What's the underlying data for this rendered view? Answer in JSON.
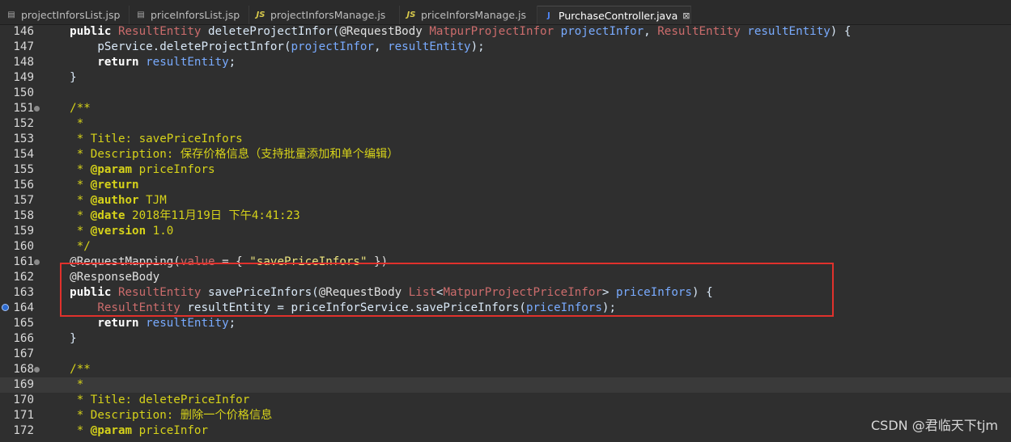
{
  "tabs": [
    {
      "label": "projectInforsList.jsp",
      "icon": "file-icon"
    },
    {
      "label": "priceInforsList.jsp",
      "icon": "file-icon"
    },
    {
      "label": "projectInforsManage.js",
      "icon": "js-file-icon"
    },
    {
      "label": "priceInforsManage.js",
      "icon": "js-file-icon"
    },
    {
      "label": "PurchaseController.java",
      "icon": "java-file-icon",
      "active": true,
      "close": "⊠"
    }
  ],
  "colors": {
    "keyword": "#cc7832",
    "keyword_bright": "#ffffff",
    "type": "#cc6c6c",
    "param": "#79abff",
    "comment": "#d6d21a",
    "annotation": "#e0e0e0",
    "string": "#ece47e",
    "default": "#d9e8f7",
    "highlight_box": "#e0312c"
  },
  "lines": [
    {
      "n": "146",
      "segs": [
        [
          "    ",
          "d"
        ],
        [
          "public",
          "kw"
        ],
        [
          " ",
          "d"
        ],
        [
          "ResultEntity",
          "t"
        ],
        [
          " deleteProjectInfor(",
          "d"
        ],
        [
          "@RequestBody",
          "a"
        ],
        [
          " ",
          "d"
        ],
        [
          "MatpurProjectInfor",
          "t"
        ],
        [
          " ",
          "d"
        ],
        [
          "projectInfor",
          "p"
        ],
        [
          ", ",
          "d"
        ],
        [
          "ResultEntity",
          "t"
        ],
        [
          " ",
          "d"
        ],
        [
          "resultEntity",
          "p"
        ],
        [
          ") {",
          "d"
        ]
      ]
    },
    {
      "n": "147",
      "segs": [
        [
          "        pService.deleteProjectInfor(",
          "d"
        ],
        [
          "projectInfor",
          "p"
        ],
        [
          ", ",
          "d"
        ],
        [
          "resultEntity",
          "p"
        ],
        [
          ");",
          "d"
        ]
      ]
    },
    {
      "n": "148",
      "segs": [
        [
          "        ",
          "d"
        ],
        [
          "return",
          "kw"
        ],
        [
          " ",
          "d"
        ],
        [
          "resultEntity",
          "p"
        ],
        [
          ";",
          "d"
        ]
      ]
    },
    {
      "n": "149",
      "segs": [
        [
          "    }",
          "d"
        ]
      ]
    },
    {
      "n": "150",
      "segs": []
    },
    {
      "n": "151",
      "fold": true,
      "segs": [
        [
          "    /**",
          "c"
        ]
      ]
    },
    {
      "n": "152",
      "segs": [
        [
          "     *",
          "c"
        ]
      ]
    },
    {
      "n": "153",
      "segs": [
        [
          "     * Title: savePriceInfors",
          "c"
        ]
      ]
    },
    {
      "n": "154",
      "segs": [
        [
          "     * Description: 保存价格信息（支持批量添加和单个编辑）",
          "c"
        ]
      ]
    },
    {
      "n": "155",
      "segs": [
        [
          "     * ",
          "c"
        ],
        [
          "@param",
          "cb"
        ],
        [
          " priceInfors",
          "c"
        ]
      ]
    },
    {
      "n": "156",
      "segs": [
        [
          "     * ",
          "c"
        ],
        [
          "@return",
          "cb"
        ]
      ]
    },
    {
      "n": "157",
      "segs": [
        [
          "     * ",
          "c"
        ],
        [
          "@author",
          "cb"
        ],
        [
          " TJM",
          "c"
        ]
      ]
    },
    {
      "n": "158",
      "segs": [
        [
          "     * ",
          "c"
        ],
        [
          "@date",
          "cb"
        ],
        [
          " 2018年11月19日 下午4:41:23",
          "c"
        ]
      ]
    },
    {
      "n": "159",
      "segs": [
        [
          "     * ",
          "c"
        ],
        [
          "@version",
          "cb"
        ],
        [
          " 1.0",
          "c"
        ]
      ]
    },
    {
      "n": "160",
      "segs": [
        [
          "     */",
          "c"
        ]
      ]
    },
    {
      "n": "161",
      "fold": true,
      "segs": [
        [
          "    @RequestMapping(",
          "a"
        ],
        [
          "value",
          "t"
        ],
        [
          " = { ",
          "a"
        ],
        [
          "\"savePriceInfors\"",
          "s"
        ],
        [
          " })",
          "a"
        ]
      ]
    },
    {
      "n": "162",
      "segs": [
        [
          "    @ResponseBody",
          "a"
        ]
      ]
    },
    {
      "n": "163",
      "segs": [
        [
          "    ",
          "d"
        ],
        [
          "public",
          "kw"
        ],
        [
          " ",
          "d"
        ],
        [
          "ResultEntity",
          "t"
        ],
        [
          " savePriceInfors(",
          "d"
        ],
        [
          "@RequestBody",
          "a"
        ],
        [
          " ",
          "d"
        ],
        [
          "List",
          "t"
        ],
        [
          "<",
          "d"
        ],
        [
          "MatpurProjectPriceInfor",
          "t"
        ],
        [
          "> ",
          "d"
        ],
        [
          "priceInfors",
          "p"
        ],
        [
          ") {",
          "d"
        ]
      ]
    },
    {
      "n": "164",
      "bp": true,
      "segs": [
        [
          "        ",
          "d"
        ],
        [
          "ResultEntity",
          "t"
        ],
        [
          " resultEntity = priceInforService.savePriceInfors(",
          "d"
        ],
        [
          "priceInfors",
          "p"
        ],
        [
          ");",
          "d"
        ]
      ]
    },
    {
      "n": "165",
      "segs": [
        [
          "        ",
          "d"
        ],
        [
          "return",
          "kw"
        ],
        [
          " ",
          "d"
        ],
        [
          "resultEntity",
          "p"
        ],
        [
          ";",
          "d"
        ]
      ]
    },
    {
      "n": "166",
      "segs": [
        [
          "    }",
          "d"
        ]
      ]
    },
    {
      "n": "167",
      "segs": []
    },
    {
      "n": "168",
      "fold": true,
      "segs": [
        [
          "    /**",
          "c"
        ]
      ]
    },
    {
      "n": "169",
      "cur": true,
      "segs": [
        [
          "     *",
          "c"
        ]
      ]
    },
    {
      "n": "170",
      "segs": [
        [
          "     * Title: deletePriceInfor",
          "c"
        ]
      ]
    },
    {
      "n": "171",
      "segs": [
        [
          "     * Description: 删除一个价格信息",
          "c"
        ]
      ]
    },
    {
      "n": "172",
      "segs": [
        [
          "     * ",
          "c"
        ],
        [
          "@param",
          "cb"
        ],
        [
          " priceInfor",
          "c"
        ]
      ]
    }
  ],
  "watermark": "CSDN @君临天下tjm"
}
